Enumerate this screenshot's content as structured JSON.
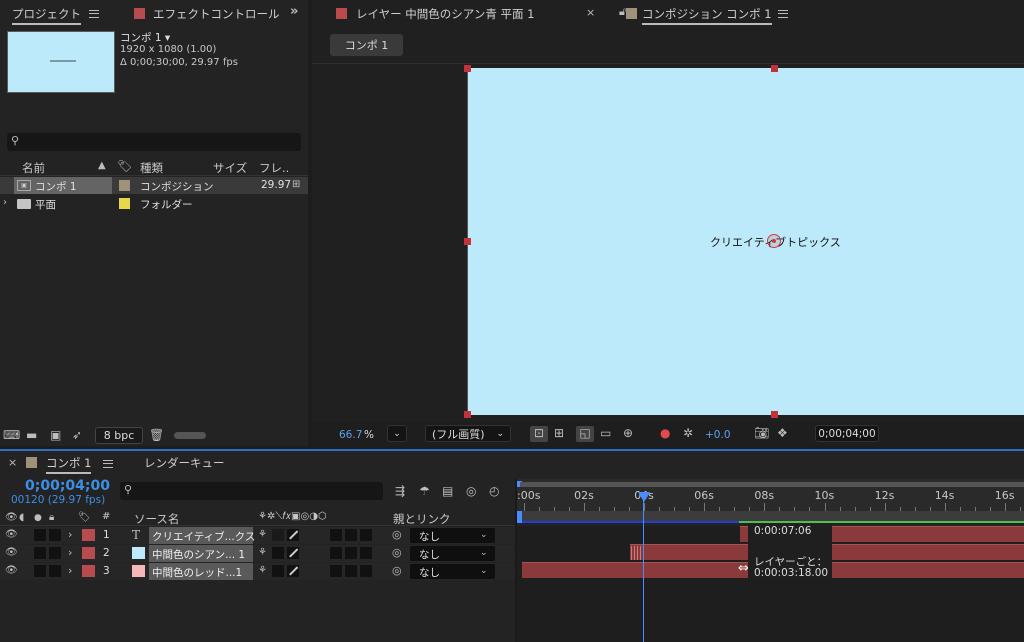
{
  "colors": {
    "accent": "#2d8ceb",
    "layer_red": "#b84b4e",
    "comp_bg": "#bdeafa",
    "label_tan": "#a0917a",
    "label_yellow": "#e6d84a",
    "work_area": "#4a8cff",
    "green_bar": "#4dc04d"
  },
  "project_panel": {
    "tab_label": "プロジェクト",
    "effects_tab": "エフェクトコントロール",
    "preview": {
      "name": "コンポ 1 ▾",
      "resolution": "1920 x 1080 (1.00)",
      "duration": "Δ 0;00;30;00, 29.97 fps"
    },
    "search_placeholder": "",
    "columns": {
      "name": "名前",
      "type": "種類",
      "size": "サイズ",
      "frame": "フレ.."
    },
    "items": [
      {
        "name": "コンポ 1",
        "type": "コンポジション",
        "frame": "29.97"
      },
      {
        "name": "平面",
        "type": "フォルダー",
        "frame": ""
      }
    ],
    "bpc": "8 bpc"
  },
  "viewer": {
    "layer_tab": "レイヤー 中間色のシアン青 平面 1",
    "comp_tab": "コンポジション コンポ 1",
    "flowchart_button": "コンポ 1",
    "comp_text": "クリエイティブトピックス",
    "zoom": "66.7",
    "zoom_unit": "%",
    "quality": "(フル画質)",
    "exposure": "+0.0",
    "timecode": "0;00;04;00"
  },
  "timeline": {
    "comp_tab": "コンポ 1",
    "render_queue_tab": "レンダーキュー",
    "current_time": "0;00;04;00",
    "current_frame": "00120 (29.97 fps)",
    "search_placeholder": "",
    "col_num": "#",
    "col_source": "ソース名",
    "col_parent": "親とリンク",
    "ruler_labels": [
      ":00s",
      "02s",
      "04s",
      "06s",
      "08s",
      "10s",
      "12s",
      "14s",
      "16s"
    ],
    "layers": [
      {
        "num": "1",
        "name": "クリエイティブ...クス",
        "parent": "なし",
        "kind": "text"
      },
      {
        "num": "2",
        "name": "中間色のシアン... 1",
        "parent": "なし",
        "kind": "solid-cyan"
      },
      {
        "num": "3",
        "name": "中間色のレッド...1",
        "parent": "なし",
        "kind": "solid-red"
      }
    ],
    "tooltip": {
      "top": "0:00:07:06",
      "label": "レイヤーごと：",
      "bottom": "0:00:03:18.00"
    }
  }
}
